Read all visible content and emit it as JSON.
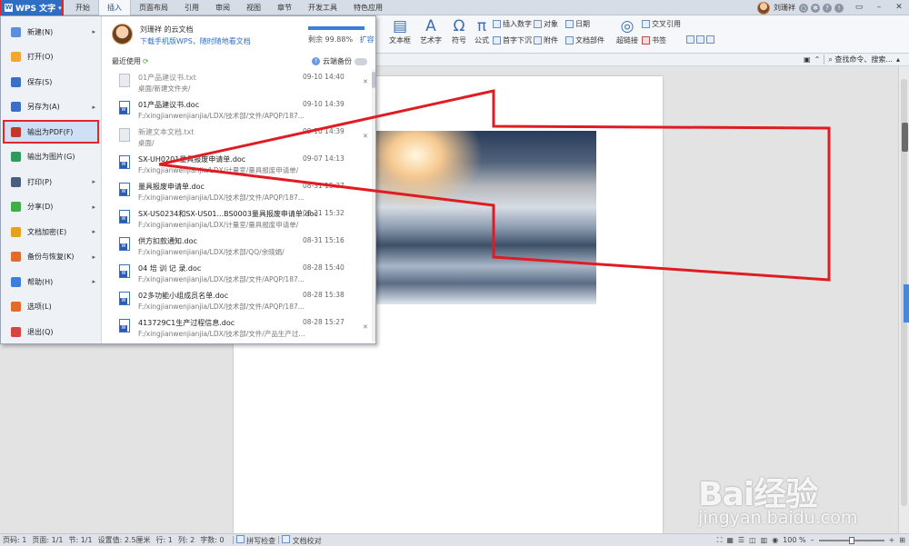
{
  "app": {
    "menu_button": "WPS 文字",
    "tabs": [
      "开始",
      "插入",
      "页面布局",
      "引用",
      "审阅",
      "视图",
      "章节",
      "开发工具",
      "特色应用"
    ],
    "active_tab": "插入",
    "user_name": "刘珊祥"
  },
  "ribbon": {
    "textbox": "文本框",
    "art": "艺术字",
    "symbol": "符号",
    "formula": "公式",
    "insert_number": "插入数字",
    "object": "对象",
    "date": "日期",
    "dropcap": "首字下沉",
    "attachment": "附件",
    "doc_parts": "文档部件",
    "cross_ref": "交叉引用",
    "hyperlink": "超链接",
    "bookmark": "书签",
    "search_placeholder": "查找命令、搜索..."
  },
  "file_menu": {
    "items": [
      {
        "label": "新建(N)",
        "icon": "new-doc-icon",
        "arrow": true,
        "color": "#5b8fd9"
      },
      {
        "label": "打开(O)",
        "icon": "open-folder-icon",
        "arrow": false,
        "color": "#f0a830"
      },
      {
        "label": "保存(S)",
        "icon": "save-icon",
        "arrow": false,
        "color": "#3a6fc4"
      },
      {
        "label": "另存为(A)",
        "icon": "save-as-icon",
        "arrow": true,
        "color": "#3a6fc4"
      },
      {
        "label": "输出为PDF(F)",
        "icon": "pdf-icon",
        "arrow": false,
        "color": "#c0392b",
        "highlight": true
      },
      {
        "label": "输出为图片(G)",
        "icon": "image-export-icon",
        "arrow": false,
        "color": "#2e9a5b"
      },
      {
        "label": "打印(P)",
        "icon": "print-icon",
        "arrow": true,
        "color": "#4a5f80"
      },
      {
        "label": "分享(D)",
        "icon": "share-icon",
        "arrow": true,
        "color": "#3fae49"
      },
      {
        "label": "文档加密(E)",
        "icon": "lock-icon",
        "arrow": true,
        "color": "#e4a21c"
      },
      {
        "label": "备份与恢复(K)",
        "icon": "backup-icon",
        "arrow": true,
        "color": "#e06b2d"
      },
      {
        "label": "帮助(H)",
        "icon": "help-icon",
        "arrow": true,
        "color": "#3d7ddb"
      },
      {
        "label": "选项(L)",
        "icon": "gear-icon",
        "arrow": false,
        "color": "#e06b2d"
      },
      {
        "label": "退出(Q)",
        "icon": "exit-icon",
        "arrow": false,
        "color": "#d64541"
      }
    ],
    "cloud": {
      "name": "刘珊祥 的云文档",
      "promo": "下载手机版WPS，随时随地看文档",
      "quota_text": "剩余 99.88%",
      "quota_fraction": 0.9988,
      "expand": "扩容"
    },
    "recent_label": "最近使用",
    "cloud_backup": "云端备份",
    "files": [
      {
        "name": "01产品建议书.txt",
        "path": "桌面/新建文件夹/",
        "date": "09-10 14:40",
        "type": "txt",
        "pin": true
      },
      {
        "name": "01产品建议书.doc",
        "path": "F:/xingjianwenjianjia/LDX/技术部/文件/APQP/187...",
        "date": "09-10 14:39",
        "type": "doc",
        "pin": false
      },
      {
        "name": "新建文本文档.txt",
        "path": "桌面/",
        "date": "09-10 14:39",
        "type": "txt",
        "pin": true
      },
      {
        "name": "SX-UH0201量具报废申请单.doc",
        "path": "F:/xingjianwenjianjia/LDX/计量室/量具报废申请单/",
        "date": "09-07 14:13",
        "type": "doc",
        "pin": false
      },
      {
        "name": "量具报废申请单.doc",
        "path": "F:/xingjianwenjianjia/LDX/技术部/文件/APQP/187...",
        "date": "08-31 15:37",
        "type": "doc",
        "pin": false
      },
      {
        "name": "SX-US0234和SX-US01...BS0003量具报废申请单.doc",
        "path": "F:/xingjianwenjianjia/LDX/计量室/量具报废申请单/",
        "date": "08-31 15:32",
        "type": "doc",
        "pin": false
      },
      {
        "name": "供方扣款通知.doc",
        "path": "F:/xingjianwenjianjia/LDX/技术部/QQ/余晓娟/",
        "date": "08-31 15:16",
        "type": "doc",
        "pin": false
      },
      {
        "name": "04 培 训 记 录.doc",
        "path": "F:/xingjianwenjianjia/LDX/技术部/文件/APQP/187...",
        "date": "08-28 15:40",
        "type": "doc",
        "pin": false
      },
      {
        "name": "02多功能小组成员名单.doc",
        "path": "F:/xingjianwenjianjia/LDX/技术部/文件/APQP/187...",
        "date": "08-28 15:38",
        "type": "doc",
        "pin": false
      },
      {
        "name": "413729C1生产过程信息.doc",
        "path": "F:/xingjianwenjianjia/LDX/技术部/文件/产品生产过...",
        "date": "08-28 15:27",
        "type": "doc",
        "pin": true
      }
    ]
  },
  "status": {
    "items": [
      "页码: 1",
      "页面: 1/1",
      "节: 1/1",
      "设置值: 2.5厘米",
      "行: 1",
      "列: 2",
      "字数: 0"
    ],
    "spell": "拼写检查",
    "proof": "文档校对",
    "zoom": "100 %",
    "zoom_fraction": 0.5
  },
  "watermark": {
    "text_big": "Bai经验",
    "text_small": "jingyan.baidu.com"
  }
}
